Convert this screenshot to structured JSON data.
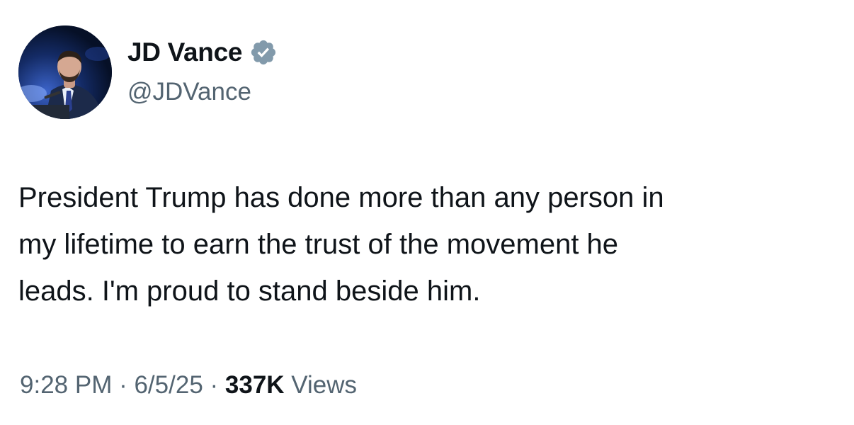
{
  "author": {
    "display_name": "JD Vance",
    "handle": "@JDVance",
    "verified_icon": "verified-badge-icon",
    "verified_color": "#829aab"
  },
  "tweet": {
    "text": "President Trump has done more than any person in\nmy lifetime to earn the trust of the movement he\nleads. I'm proud to stand beside him."
  },
  "meta": {
    "time": "9:28 PM",
    "separator": " · ",
    "date": "6/5/25",
    "views_count": "337K",
    "views_label": " Views"
  },
  "colors": {
    "text_primary": "#0f1419",
    "text_secondary": "#536471",
    "background": "#ffffff"
  }
}
